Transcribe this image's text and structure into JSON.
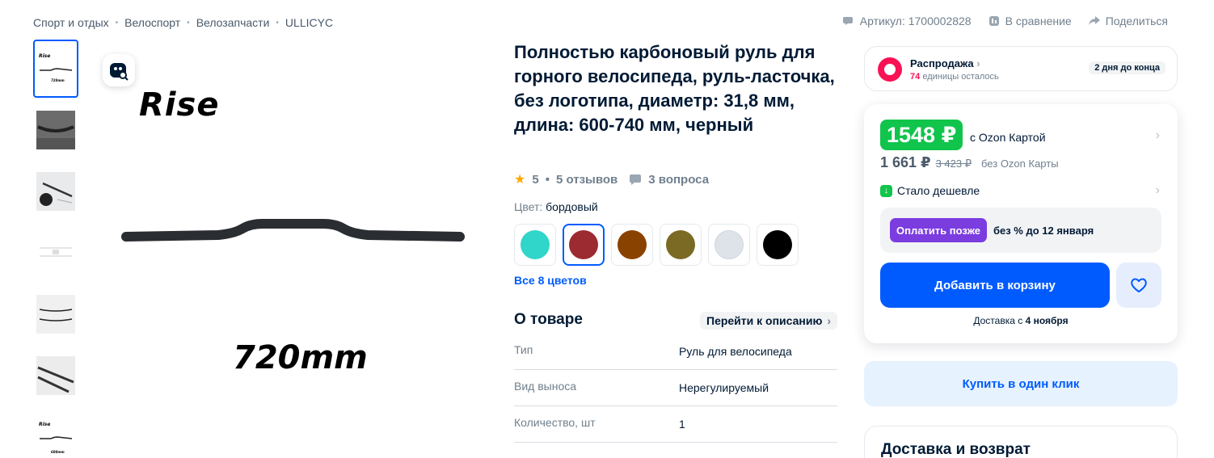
{
  "breadcrumbs": [
    "Спорт и отдых",
    "Велоспорт",
    "Велозапчасти",
    "ULLICYC"
  ],
  "top_actions": {
    "article": "Артикул: 1700002828",
    "compare": "В сравнение",
    "share": "Поделиться"
  },
  "gallery": {
    "thumbnails": [
      "thumb-1",
      "thumb-2",
      "thumb-3",
      "thumb-4",
      "thumb-5",
      "thumb-6",
      "thumb-7"
    ],
    "active_index": 0,
    "image_text_top": "Rise",
    "image_text_bottom": "720mm"
  },
  "product": {
    "title": "Полностью карбоновый руль для горного велосипеда, руль-ласточка, без логотипа, диаметр: 31,8 мм, длина: 600-740 мм, черный",
    "rating": "5",
    "reviews": "5 отзывов",
    "questions": "3 вопроса",
    "color_label": "Цвет:",
    "color_value": "бордовый",
    "swatches": [
      "#2fd6c9",
      "#9b2a31",
      "#8a4200",
      "#7a6a24",
      "#dde3e9",
      "#000000"
    ],
    "selected_swatch": 1,
    "all_colors": "Все 8 цветов"
  },
  "about": {
    "heading": "О товаре",
    "goto_description": "Перейти к описанию",
    "specs": [
      {
        "k": "Тип",
        "v": "Руль для велосипеда"
      },
      {
        "k": "Вид выноса",
        "v": "Нерегулируемый"
      },
      {
        "k": "Количество, шт",
        "v": "1"
      }
    ]
  },
  "sale": {
    "title": "Распродажа",
    "units": "74",
    "units_text": "единицы осталось",
    "days_left": "2 дня до конца"
  },
  "price": {
    "ozon_price": "1548 ₽",
    "ozon_card_label": "с Ozon Картой",
    "regular_price": "1 661 ₽",
    "old_price": "3 423 ₽",
    "without_card": "без Ozon Карты",
    "cheaper": "Стало дешевле",
    "pay_later_btn": "Оплатить позже",
    "pay_later_text": "без % до 12 января",
    "add_to_cart": "Добавить в корзину",
    "delivery_prefix": "Доставка с",
    "delivery_date": "4 ноября"
  },
  "one_click": "Купить в один клик",
  "delivery_card": {
    "heading": "Доставка и возврат"
  },
  "colors": {
    "accent": "#005bff",
    "ozon_green": "#10c44c",
    "sale_pink": "#f91155",
    "pay_later_purple": "#7b3ce0"
  }
}
